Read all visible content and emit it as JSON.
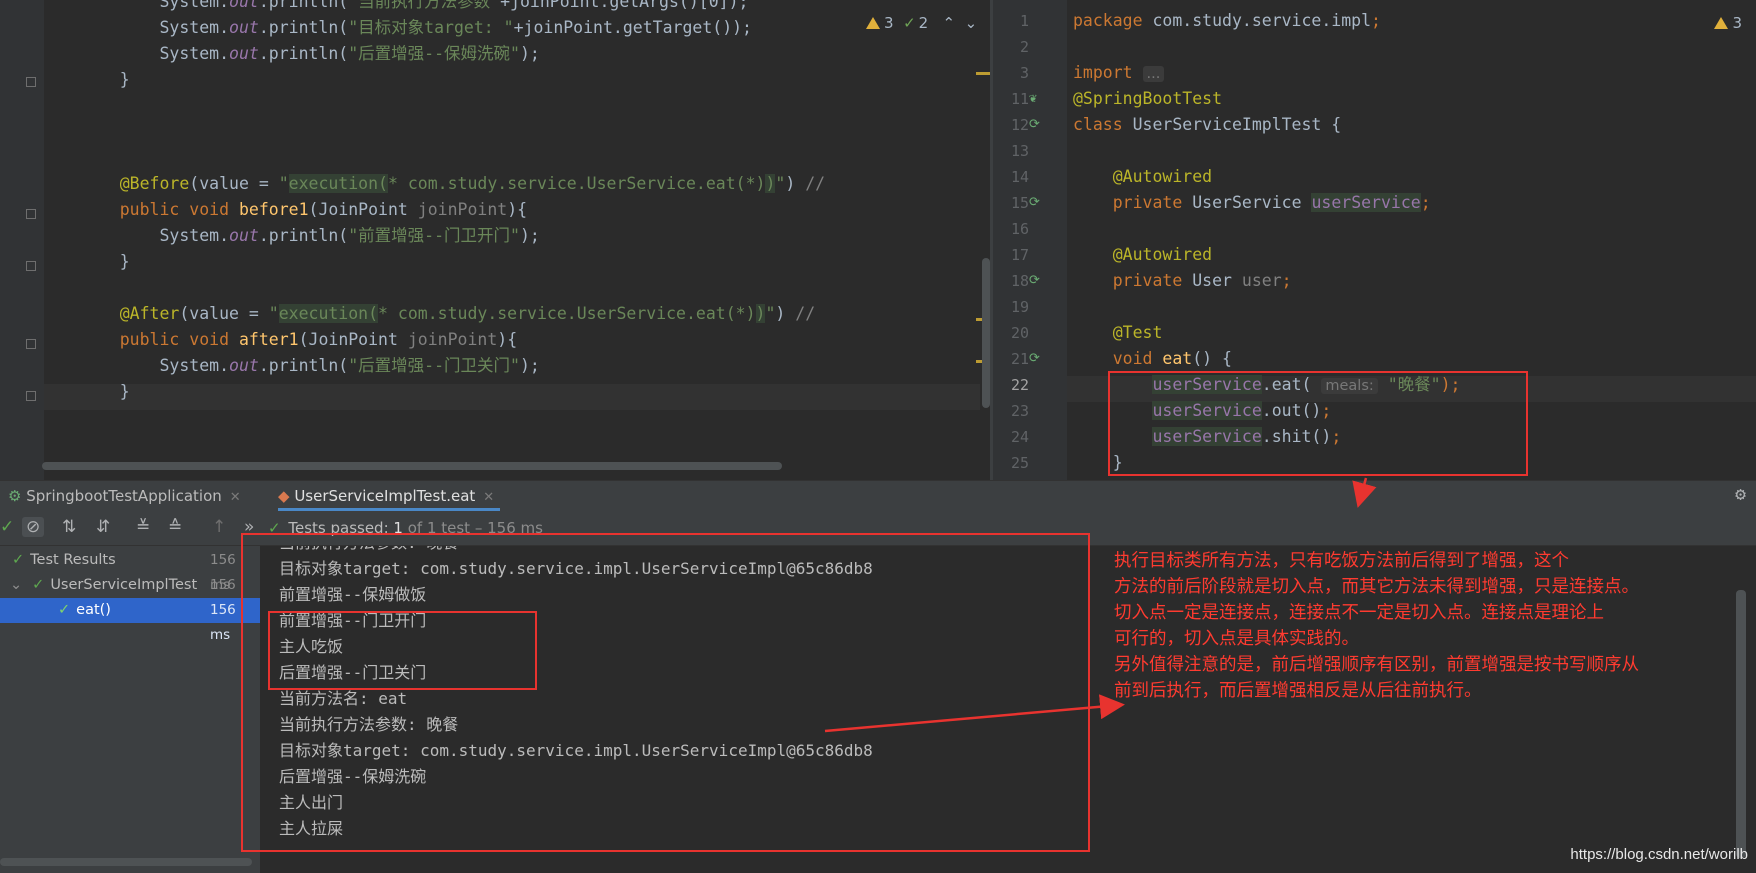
{
  "left_editor": {
    "lines": [
      {
        "segments": [
          {
            "t": "        System.",
            "c": ""
          },
          {
            "t": "out",
            "c": "it"
          },
          {
            "t": ".println(",
            "c": ""
          },
          {
            "t": "\"当前执行方法参数\"",
            "c": "str"
          },
          {
            "t": "+joinPoint.getArgs()[0]);",
            "c": ""
          }
        ]
      },
      {
        "segments": [
          {
            "t": "        System.",
            "c": ""
          },
          {
            "t": "out",
            "c": "it"
          },
          {
            "t": ".println(",
            "c": ""
          },
          {
            "t": "\"目标对象target: \"",
            "c": "str"
          },
          {
            "t": "+joinPoint.getTarget());",
            "c": ""
          }
        ]
      },
      {
        "segments": [
          {
            "t": "        System.",
            "c": ""
          },
          {
            "t": "out",
            "c": "it"
          },
          {
            "t": ".println(",
            "c": ""
          },
          {
            "t": "\"后置增强--保姆洗碗\"",
            "c": "str"
          },
          {
            "t": ");",
            "c": ""
          }
        ]
      },
      {
        "segments": [
          {
            "t": "    }",
            "c": ""
          }
        ]
      },
      {
        "segments": [
          {
            "t": "",
            "c": ""
          }
        ]
      },
      {
        "segments": [
          {
            "t": "",
            "c": ""
          }
        ]
      },
      {
        "segments": [
          {
            "t": "",
            "c": ""
          }
        ]
      },
      {
        "segments": [
          {
            "t": "    ",
            "c": ""
          },
          {
            "t": "@Before",
            "c": "ann"
          },
          {
            "t": "(value = ",
            "c": ""
          },
          {
            "t": "\"",
            "c": "str"
          },
          {
            "t": "execution(",
            "c": "str-hl"
          },
          {
            "t": "* com.study.service.UserService.eat(*)",
            "c": "str"
          },
          {
            "t": ")",
            "c": "str-hl"
          },
          {
            "t": "\"",
            "c": "str"
          },
          {
            "t": ") ",
            "c": ""
          },
          {
            "t": "//",
            "c": "cmt"
          }
        ]
      },
      {
        "segments": [
          {
            "t": "    ",
            "c": ""
          },
          {
            "t": "public void ",
            "c": "kw"
          },
          {
            "t": "before1",
            "c": "fn"
          },
          {
            "t": "(JoinPoint ",
            "c": ""
          },
          {
            "t": "joinPoint",
            "c": "param"
          },
          {
            "t": "){",
            "c": ""
          }
        ]
      },
      {
        "segments": [
          {
            "t": "        System.",
            "c": ""
          },
          {
            "t": "out",
            "c": "it"
          },
          {
            "t": ".println(",
            "c": ""
          },
          {
            "t": "\"前置增强--门卫开门\"",
            "c": "str"
          },
          {
            "t": ");",
            "c": ""
          }
        ]
      },
      {
        "segments": [
          {
            "t": "    }",
            "c": ""
          }
        ]
      },
      {
        "segments": [
          {
            "t": "",
            "c": ""
          }
        ]
      },
      {
        "segments": [
          {
            "t": "    ",
            "c": ""
          },
          {
            "t": "@After",
            "c": "ann"
          },
          {
            "t": "(value = ",
            "c": ""
          },
          {
            "t": "\"",
            "c": "str"
          },
          {
            "t": "execution(",
            "c": "str-hl"
          },
          {
            "t": "* com.study.service.UserService.eat(*)",
            "c": "str"
          },
          {
            "t": ")",
            "c": "str-hl"
          },
          {
            "t": "\"",
            "c": "str"
          },
          {
            "t": ") ",
            "c": ""
          },
          {
            "t": "//",
            "c": "cmt"
          }
        ]
      },
      {
        "segments": [
          {
            "t": "    ",
            "c": ""
          },
          {
            "t": "public void ",
            "c": "kw"
          },
          {
            "t": "after1",
            "c": "fn"
          },
          {
            "t": "(JoinPoint ",
            "c": ""
          },
          {
            "t": "joinPoint",
            "c": "param"
          },
          {
            "t": "){",
            "c": ""
          }
        ]
      },
      {
        "segments": [
          {
            "t": "        System.",
            "c": ""
          },
          {
            "t": "out",
            "c": "it"
          },
          {
            "t": ".println(",
            "c": ""
          },
          {
            "t": "\"后置增强--门卫关门\"",
            "c": "str"
          },
          {
            "t": ");",
            "c": ""
          }
        ]
      },
      {
        "segments": [
          {
            "t": "    }",
            "c": ""
          }
        ]
      }
    ],
    "inspection": {
      "warnings": "3",
      "ok": "2"
    }
  },
  "right_editor": {
    "lines": [
      {
        "num": "1",
        "segments": [
          {
            "t": "package ",
            "c": "kw"
          },
          {
            "t": "com.study.service.impl",
            "c": ""
          },
          {
            "t": ";",
            "c": "kw"
          }
        ]
      },
      {
        "num": "2",
        "segments": [
          {
            "t": "",
            "c": ""
          }
        ]
      },
      {
        "num": "3",
        "segments": [
          {
            "t": "import ",
            "c": "kw"
          },
          {
            "t": "...",
            "c": "hint"
          }
        ]
      },
      {
        "num": "11",
        "segments": [
          {
            "t": "@SpringBootTest",
            "c": "ann"
          }
        ]
      },
      {
        "num": "12",
        "segments": [
          {
            "t": "class ",
            "c": "kw"
          },
          {
            "t": "UserServiceImplTest {",
            "c": ""
          }
        ]
      },
      {
        "num": "13",
        "segments": [
          {
            "t": "",
            "c": ""
          }
        ]
      },
      {
        "num": "14",
        "segments": [
          {
            "t": "    ",
            "c": ""
          },
          {
            "t": "@Autowired",
            "c": "ann"
          }
        ]
      },
      {
        "num": "15",
        "segments": [
          {
            "t": "    ",
            "c": ""
          },
          {
            "t": "private ",
            "c": "kw"
          },
          {
            "t": "UserService ",
            "c": ""
          },
          {
            "t": "userService",
            "c": "field-hl"
          },
          {
            "t": ";",
            "c": "kw"
          }
        ]
      },
      {
        "num": "16",
        "segments": [
          {
            "t": "",
            "c": ""
          }
        ]
      },
      {
        "num": "17",
        "segments": [
          {
            "t": "    ",
            "c": ""
          },
          {
            "t": "@Autowired",
            "c": "ann"
          }
        ]
      },
      {
        "num": "18",
        "segments": [
          {
            "t": "    ",
            "c": ""
          },
          {
            "t": "private ",
            "c": "kw"
          },
          {
            "t": "User ",
            "c": ""
          },
          {
            "t": "user",
            "c": "param"
          },
          {
            "t": ";",
            "c": "kw"
          }
        ]
      },
      {
        "num": "19",
        "segments": [
          {
            "t": "",
            "c": ""
          }
        ]
      },
      {
        "num": "20",
        "segments": [
          {
            "t": "    ",
            "c": ""
          },
          {
            "t": "@Test",
            "c": "ann"
          }
        ]
      },
      {
        "num": "21",
        "segments": [
          {
            "t": "    ",
            "c": ""
          },
          {
            "t": "void ",
            "c": "kw"
          },
          {
            "t": "eat",
            "c": "fn"
          },
          {
            "t": "() {",
            "c": ""
          }
        ]
      },
      {
        "num": "22",
        "segments": [
          {
            "t": "        ",
            "c": ""
          },
          {
            "t": "userService",
            "c": "field-hl"
          },
          {
            "t": ".eat( ",
            "c": ""
          },
          {
            "t": "meals:",
            "c": "hint"
          },
          {
            "t": " \"晚餐\"",
            "c": "str"
          },
          {
            "t": ");",
            "c": "kw"
          }
        ]
      },
      {
        "num": "23",
        "segments": [
          {
            "t": "        ",
            "c": ""
          },
          {
            "t": "userService",
            "c": "field-hl"
          },
          {
            "t": ".out()",
            "c": ""
          },
          {
            "t": ";",
            "c": "kw"
          }
        ]
      },
      {
        "num": "24",
        "segments": [
          {
            "t": "        ",
            "c": ""
          },
          {
            "t": "userService",
            "c": "field-hl"
          },
          {
            "t": ".shit()",
            "c": ""
          },
          {
            "t": ";",
            "c": "kw"
          }
        ]
      },
      {
        "num": "25",
        "segments": [
          {
            "t": "    }",
            "c": ""
          }
        ]
      }
    ],
    "current_line": "22",
    "inspection": {
      "warnings": "3"
    }
  },
  "tabs": [
    {
      "label": "SpringbootTestApplication",
      "active": false
    },
    {
      "label": "UserServiceImplTest.eat",
      "active": true
    }
  ],
  "toolbar": {
    "status_label": "Tests passed: ",
    "status_count": "1",
    "status_detail": " of 1 test – 156 ms"
  },
  "tree": [
    {
      "label": "Test Results",
      "time": "156 ms",
      "indent": 0,
      "arrow": ""
    },
    {
      "label": "UserServiceImplTest",
      "time": "156 ms",
      "indent": 1,
      "arrow": "⌄"
    },
    {
      "label": "eat()",
      "time": "156 ms",
      "indent": 2,
      "arrow": "",
      "selected": true
    }
  ],
  "console_lines": [
    "当前执行方法参数: 晚餐",
    "目标对象target: com.study.service.impl.UserServiceImpl@65c86db8",
    "前置增强--保姆做饭",
    "前置增强--门卫开门",
    "主人吃饭",
    "后置增强--门卫关门",
    "当前方法名: eat",
    "当前执行方法参数: 晚餐",
    "目标对象target: com.study.service.impl.UserServiceImpl@65c86db8",
    "后置增强--保姆洗碗",
    "主人出门",
    "主人拉屎"
  ],
  "annotation_lines": [
    "执行目标类所有方法，只有吃饭方法前后得到了增强，这个",
    "方法的前后阶段就是切入点，而其它方法未得到增强，只是连接点。",
    "切入点一定是连接点，连接点不一定是切入点。连接点是理论上",
    "可行的，切入点是具体实践的。",
    "另外值得注意的是，前后增强顺序有区别，前置增强是按书写顺序从",
    "前到后执行，而后置增强相反是从后往前执行。"
  ],
  "watermark": "https://blog.csdn.net/worilb",
  "colors": {
    "accent_red": "#e8332f",
    "selection": "#2f65ca",
    "pass_green": "#5ea84f"
  }
}
